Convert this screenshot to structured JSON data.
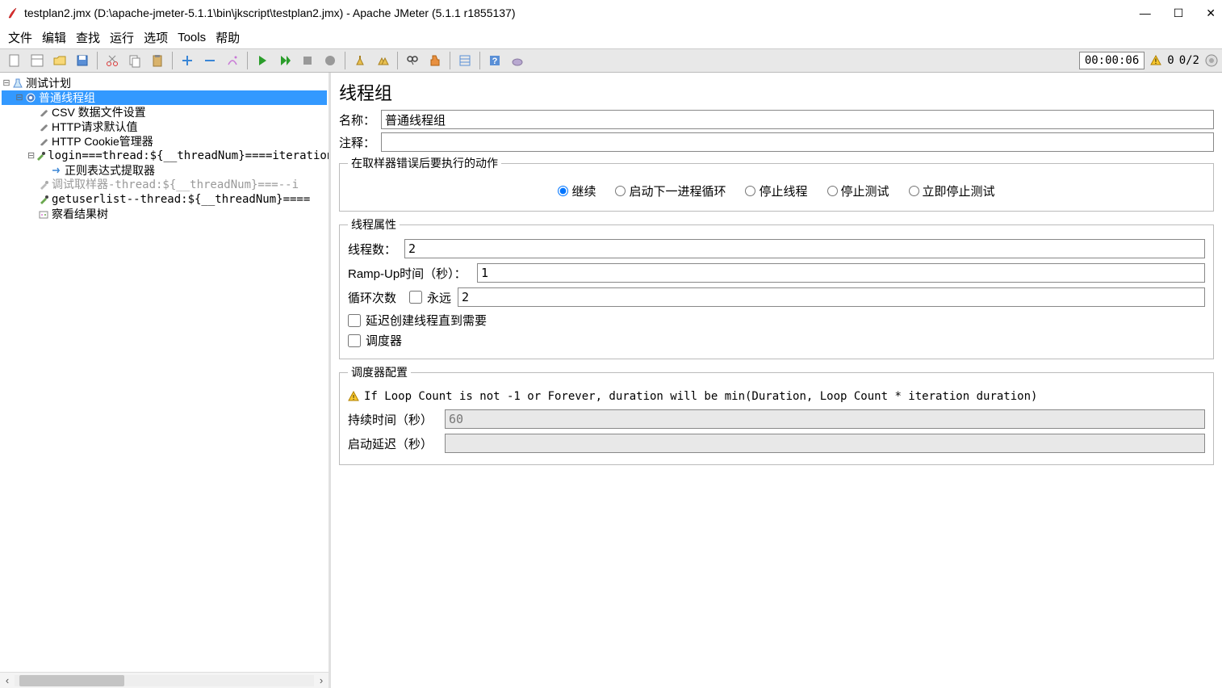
{
  "window": {
    "title": "testplan2.jmx (D:\\apache-jmeter-5.1.1\\bin\\jkscript\\testplan2.jmx) - Apache JMeter (5.1.1 r1855137)"
  },
  "menu": {
    "file": "文件",
    "edit": "编辑",
    "search": "查找",
    "run": "运行",
    "options": "选项",
    "tools": "Tools",
    "help": "帮助"
  },
  "status": {
    "timer": "00:00:06",
    "warnings": "0",
    "threads": "0/2"
  },
  "tree": {
    "root": "测试计划",
    "thread_group": "普通线程组",
    "csv": "CSV 数据文件设置",
    "http_defaults": "HTTP请求默认值",
    "cookie": "HTTP Cookie管理器",
    "login": "login===thread:${__threadNum}====iteration:${__i}",
    "regex": "正则表达式提取器",
    "debug": "调试取样器-thread:${__threadNum}===--i",
    "getuserlist": "getuserlist--thread:${__threadNum}====",
    "view_results": "察看结果树"
  },
  "panel": {
    "title": "线程组",
    "name_label": "名称：",
    "name_value": "普通线程组",
    "comment_label": "注释：",
    "comment_value": "",
    "error_group": "在取样器错误后要执行的动作",
    "radio_continue": "继续",
    "radio_next_loop": "启动下一进程循环",
    "radio_stop_thread": "停止线程",
    "radio_stop_test": "停止测试",
    "radio_stop_now": "立即停止测试",
    "thread_props": "线程属性",
    "threads_label": "线程数：",
    "threads_value": "2",
    "rampup_label": "Ramp-Up时间（秒）：",
    "rampup_value": "1",
    "loop_label": "循环次数",
    "forever_label": "永远",
    "loop_value": "2",
    "delay_create": "延迟创建线程直到需要",
    "scheduler": "调度器",
    "scheduler_group": "调度器配置",
    "warn_text": "If Loop Count is not -1 or Forever, duration will be min(Duration, Loop Count * iteration duration)",
    "duration_label": "持续时间（秒）",
    "duration_value": "60",
    "startup_delay_label": "启动延迟（秒）",
    "startup_delay_value": ""
  }
}
